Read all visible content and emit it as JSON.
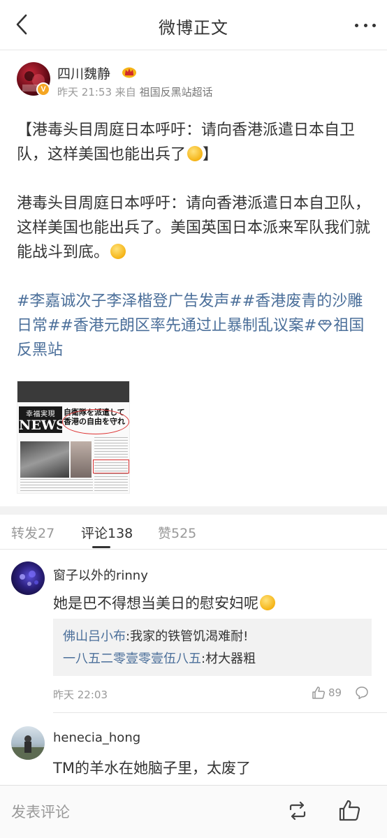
{
  "header": {
    "title": "微博正文",
    "back_icon": "chevron-left-icon",
    "more_icon": "more-dots-icon"
  },
  "post": {
    "author": "四川魏静",
    "avatar_badge": "V",
    "time": "昨天 21:53",
    "from_label": "来自",
    "source": "祖国反黑站超话",
    "title_text": "【港毒头目周庭日本呼吁：请向香港派遣日本自卫队，这样美国也能出兵了",
    "title_close": "】",
    "body_text": "港毒头目周庭日本呼吁：请向香港派遣日本自卫队，这样美国也能出兵了。美国英国日本派来军队我们就能战斗到底。",
    "topics_line": "#李嘉诚次子李泽楷登广告发声##香港废青的沙雕日常##香港元朗区率先通过止暴制乱议案#",
    "topic_tail": "祖国反黑站",
    "image": {
      "masthead_small": "幸福実現",
      "masthead_big": "NEWS",
      "headline": "自衛隊を派遣して香港の自由を守れ"
    }
  },
  "tabs": {
    "repost": "转发27",
    "comments": "评论138",
    "likes": "赞525"
  },
  "comments": [
    {
      "name": "窗子以外的rinny",
      "text": "她是巴不得想当美日的慰安妇呢",
      "replies": [
        {
          "name": "佛山吕小布",
          "text": ":我家的铁管饥渴难耐!"
        },
        {
          "name": "一八五二零壹零壹伍八五",
          "text": ":材大器粗"
        }
      ],
      "time": "昨天 22:03",
      "likes": "89"
    },
    {
      "name": "henecia_hong",
      "text": "TM的羊水在她脑子里，太废了"
    }
  ],
  "bottom": {
    "input_placeholder": "发表评论"
  },
  "colors": {
    "link_blue": "#4b6f9a",
    "badge_orange": "#f5a623",
    "text_dark": "#333333",
    "text_gray": "#999999"
  }
}
